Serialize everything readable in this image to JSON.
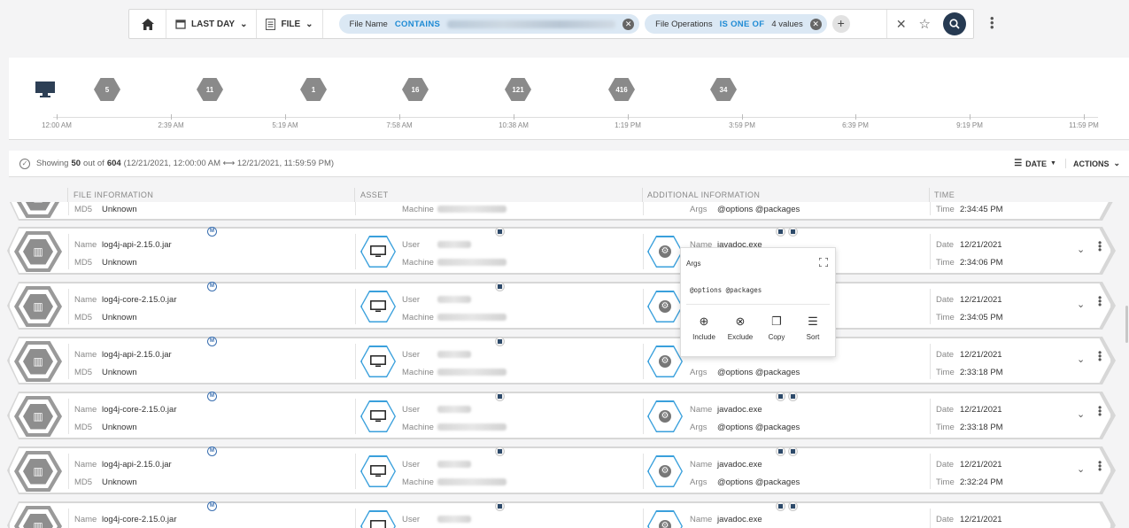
{
  "filterbar": {
    "time_range": "LAST DAY",
    "entity": "FILE",
    "chips": [
      {
        "field": "File Name",
        "operator": "CONTAINS",
        "value": ""
      },
      {
        "field": "File Operations",
        "operator": "IS ONE OF",
        "value": "4 values"
      }
    ]
  },
  "timeline": {
    "buckets": [
      "5",
      "11",
      "1",
      "16",
      "121",
      "416",
      "34"
    ],
    "ticks": [
      "12:00 AM",
      "2:39 AM",
      "5:19 AM",
      "7:58 AM",
      "10:38 AM",
      "1:19 PM",
      "3:59 PM",
      "6:39 PM",
      "9:19 PM",
      "11:59 PM"
    ]
  },
  "summary": {
    "prefix": "Showing",
    "shown": "50",
    "mid": "out of",
    "total": "604",
    "range": "(12/21/2021, 12:00:00 AM  ⟷  12/21/2021, 11:59:59 PM)",
    "sort_label": "DATE",
    "actions_label": "ACTIONS"
  },
  "columns": [
    "FILE INFORMATION",
    "ASSET",
    "ADDITIONAL INFORMATION",
    "TIME"
  ],
  "labels": {
    "name": "Name",
    "md5": "MD5",
    "user": "User",
    "machine": "Machine",
    "args": "Args",
    "date": "Date",
    "time": "Time"
  },
  "rows": [
    {
      "file_name": "",
      "md5": "Unknown",
      "proc_name": "",
      "args": "@options @packages",
      "date": "",
      "time": "2:34:45 PM"
    },
    {
      "file_name": "log4j-api-2.15.0.jar",
      "md5": "Unknown",
      "proc_name": "javadoc.exe",
      "args": "",
      "date": "12/21/2021",
      "time": "2:34:06 PM"
    },
    {
      "file_name": "log4j-core-2.15.0.jar",
      "md5": "Unknown",
      "proc_name": "",
      "args": "",
      "date": "12/21/2021",
      "time": "2:34:05 PM"
    },
    {
      "file_name": "log4j-api-2.15.0.jar",
      "md5": "Unknown",
      "proc_name": "",
      "args": "@options @packages",
      "date": "12/21/2021",
      "time": "2:33:18 PM"
    },
    {
      "file_name": "log4j-core-2.15.0.jar",
      "md5": "Unknown",
      "proc_name": "javadoc.exe",
      "args": "@options @packages",
      "date": "12/21/2021",
      "time": "2:33:18 PM"
    },
    {
      "file_name": "log4j-api-2.15.0.jar",
      "md5": "Unknown",
      "proc_name": "javadoc.exe",
      "args": "@options @packages",
      "date": "12/21/2021",
      "time": "2:32:24 PM"
    },
    {
      "file_name": "log4j-core-2.15.0.jar",
      "md5": "",
      "proc_name": "javadoc.exe",
      "args": "",
      "date": "12/21/2021",
      "time": ""
    }
  ],
  "popup": {
    "title": "Args",
    "value": "@options @packages",
    "actions": [
      "Include",
      "Exclude",
      "Copy",
      "Sort"
    ]
  }
}
